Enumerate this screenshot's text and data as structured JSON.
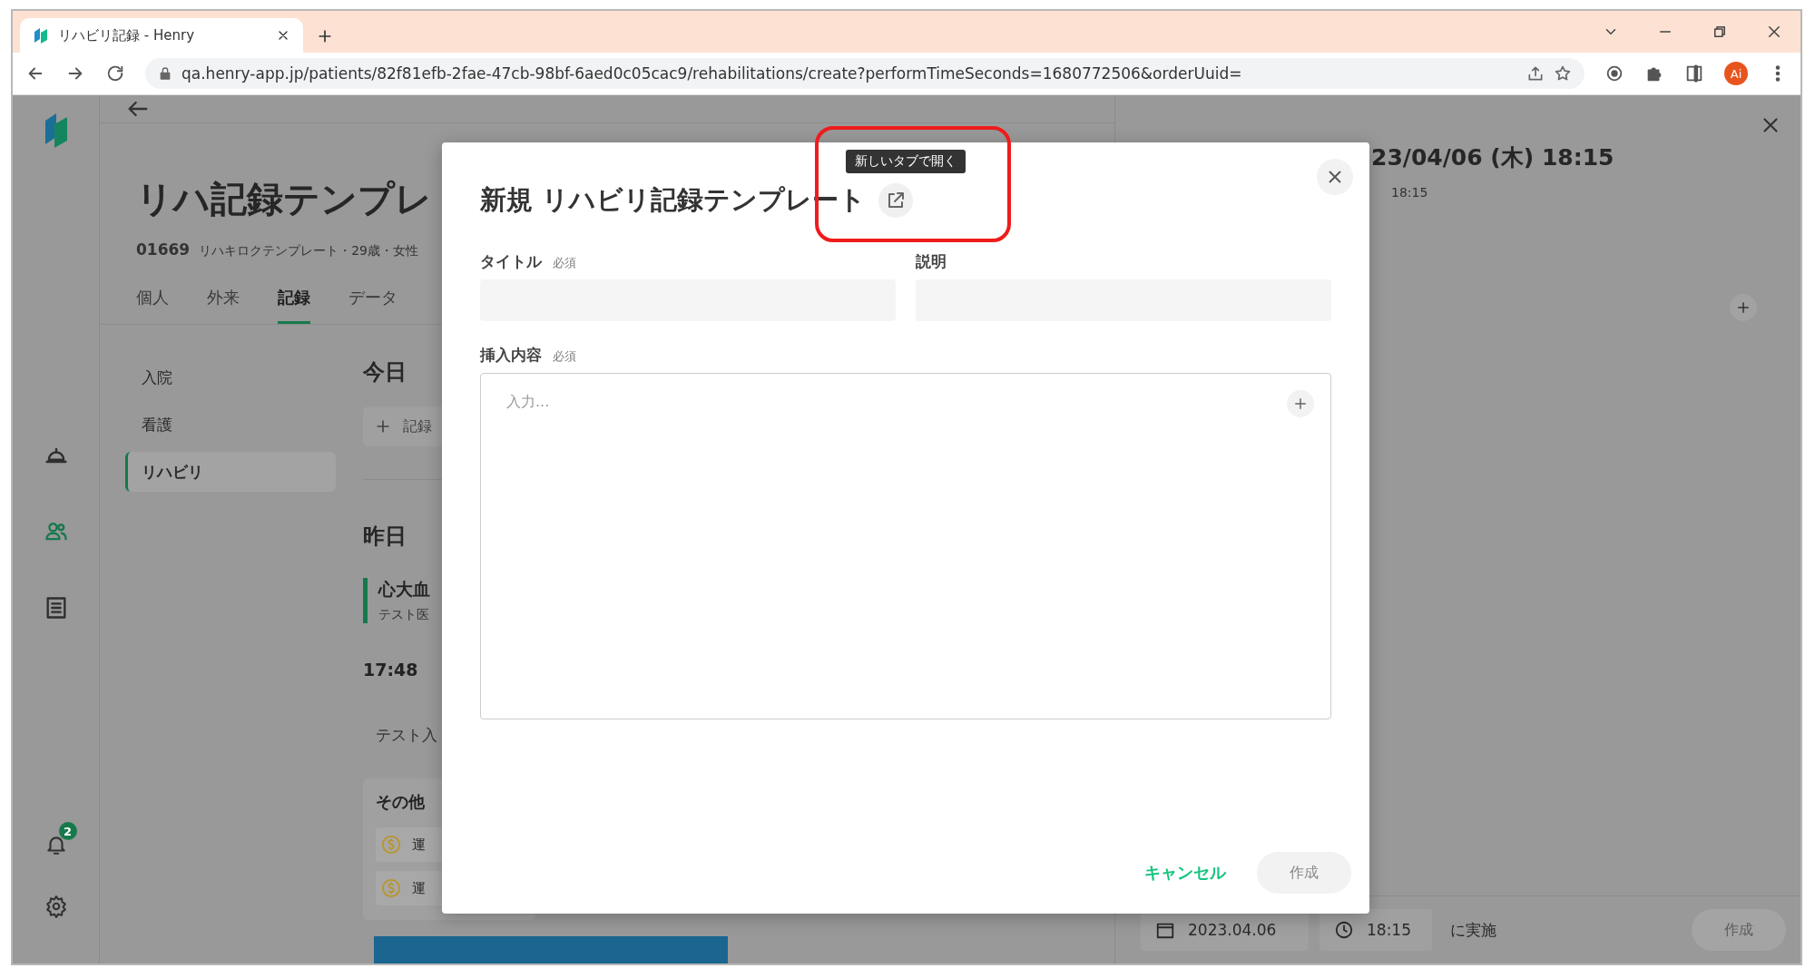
{
  "browser": {
    "tab_title": "リハビリ記録 - Henry",
    "url": "qa.henry-app.jp/patients/82f81efb-2fae-47cb-98bf-6aed0c05cac9/rehabilitations/create?performTimeSeconds=1680772506&orderUuid=",
    "profile_initials": "Ai"
  },
  "rail": {
    "items": [
      {
        "kind": "cloche",
        "selected": false
      },
      {
        "kind": "people",
        "selected": true
      },
      {
        "kind": "list",
        "selected": false
      }
    ],
    "notification_count": "2"
  },
  "patient": {
    "title": "リハ記録テンプレ",
    "id": "01669",
    "summary": "リハキロクテンプレート・29歳・女性",
    "tabs": [
      {
        "label": "個人",
        "selected": false
      },
      {
        "label": "外来",
        "selected": false
      },
      {
        "label": "記録",
        "selected": true
      },
      {
        "label": "データ",
        "selected": false
      }
    ]
  },
  "record_nav": [
    {
      "label": "入院",
      "selected": false
    },
    {
      "label": "看護",
      "selected": false
    },
    {
      "label": "リハビリ",
      "selected": true
    }
  ],
  "timeline": {
    "today": "今日",
    "add_button": "記録",
    "yesterday": "昨日",
    "card": {
      "title": "心大血",
      "subtitle": "テスト医"
    },
    "entry": {
      "time": "17:48"
    },
    "note": "テスト入",
    "group": {
      "title": "その他",
      "rows": [
        "運",
        "運"
      ]
    }
  },
  "detail": {
    "title": "23/04/06 (木) 18:15",
    "subtitle": "18:15",
    "date": "2023.04.06",
    "time": "18:15",
    "suffix": "に実施",
    "create_button": {
      "label": "作成",
      "disabled": true
    }
  },
  "dialog": {
    "title": "新規 リハビリ記録テンプレート",
    "tooltip": "新しいタブで開く",
    "fields": [
      {
        "label": "タイトル",
        "required": "必須"
      },
      {
        "label": "説明"
      }
    ],
    "content": {
      "label": "挿入内容",
      "required": "必須",
      "placeholder": "入力..."
    },
    "cancel_button": "キャンセル",
    "create_button": {
      "label": "作成",
      "disabled": true
    }
  }
}
